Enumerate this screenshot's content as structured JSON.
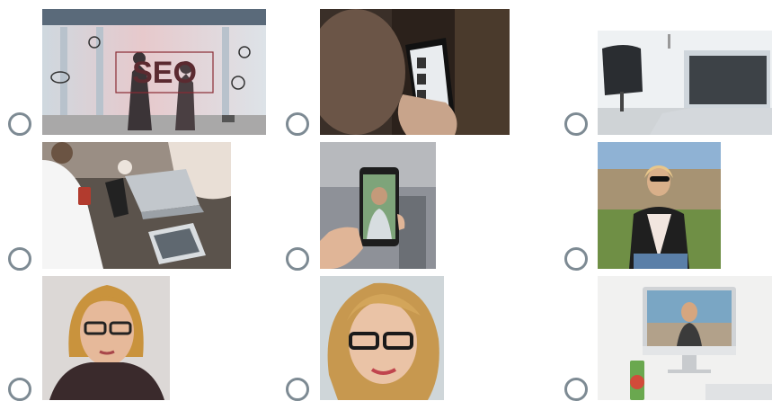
{
  "question": {
    "options": [
      {
        "id": "opt-1",
        "image": "seo-businessman-cityscape",
        "selected": false,
        "overlay_text": "SEO"
      },
      {
        "id": "opt-2",
        "image": "hand-holding-smartphone-shopping-app",
        "selected": false
      },
      {
        "id": "opt-3",
        "image": "laptop-in-bright-office",
        "selected": false
      },
      {
        "id": "opt-4",
        "image": "people-working-with-laptop-tablet-phone",
        "selected": false
      },
      {
        "id": "opt-5",
        "image": "hand-holding-phone-woman-on-screen",
        "selected": false
      },
      {
        "id": "opt-6",
        "image": "woman-sunglasses-park",
        "selected": false
      },
      {
        "id": "opt-7",
        "image": "woman-glasses-portrait",
        "selected": false
      },
      {
        "id": "opt-8",
        "image": "woman-glasses-closeup-portrait",
        "selected": false
      },
      {
        "id": "opt-9",
        "image": "desktop-computer-woman-on-screen",
        "selected": false
      }
    ]
  },
  "colors": {
    "radio_border": "#7d8a93",
    "background": "#ffffff"
  }
}
